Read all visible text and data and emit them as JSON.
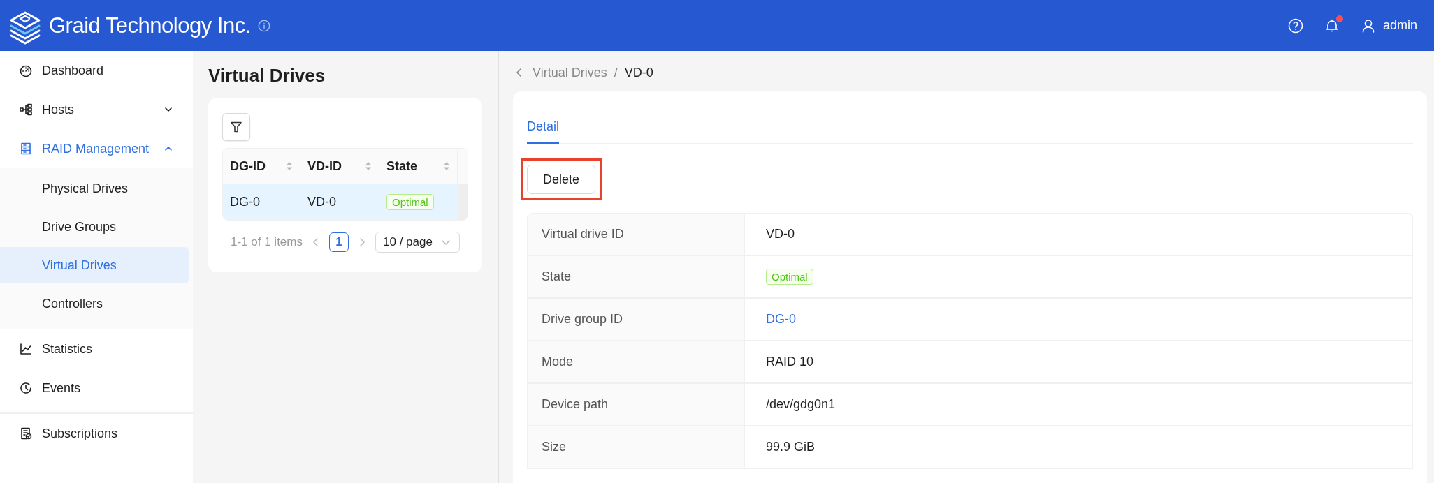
{
  "header": {
    "brand": "Graid Technology Inc.",
    "user": "admin",
    "notification_badge": true
  },
  "sidebar": {
    "items": [
      {
        "kind": "dashboard",
        "label": "Dashboard",
        "selected": false
      },
      {
        "kind": "hosts",
        "label": "Hosts",
        "selected": false,
        "expanded": false
      },
      {
        "kind": "raid",
        "label": "RAID Management",
        "selected": true,
        "expanded": true,
        "children": [
          {
            "label": "Physical Drives",
            "selected": false
          },
          {
            "label": "Drive Groups",
            "selected": false
          },
          {
            "label": "Virtual Drives",
            "selected": true
          },
          {
            "label": "Controllers",
            "selected": false
          }
        ]
      },
      {
        "kind": "statistics",
        "label": "Statistics",
        "selected": false
      },
      {
        "kind": "events",
        "label": "Events",
        "selected": false
      }
    ],
    "bottom_items": [
      {
        "kind": "subscriptions",
        "label": "Subscriptions",
        "selected": false
      }
    ]
  },
  "list_panel": {
    "title": "Virtual Drives",
    "table": {
      "columns": [
        "DG-ID",
        "VD-ID",
        "State"
      ],
      "rows": [
        {
          "dg_id": "DG-0",
          "vd_id": "VD-0",
          "state": "Optimal",
          "selected": true
        }
      ]
    },
    "pagination": {
      "summary": "1-1 of 1 items",
      "pages": [
        {
          "label": "1",
          "selected": true
        }
      ],
      "page_size": "10 / page"
    }
  },
  "detail_panel": {
    "breadcrumb": {
      "items": [
        "Virtual Drives",
        "VD-0"
      ],
      "separator": "/"
    },
    "tabs": [
      {
        "label": "Detail",
        "selected": true
      }
    ],
    "actions": [
      {
        "label": "Delete",
        "highlighted": true
      }
    ],
    "fields": [
      {
        "kind": "text",
        "label": "Virtual drive ID",
        "value": "VD-0"
      },
      {
        "kind": "tag",
        "label": "State",
        "value": "Optimal"
      },
      {
        "kind": "link",
        "label": "Drive group ID",
        "value": "DG-0"
      },
      {
        "kind": "text",
        "label": "Mode",
        "value": "RAID 10"
      },
      {
        "kind": "text",
        "label": "Device path",
        "value": "/dev/gdg0n1"
      },
      {
        "kind": "text",
        "label": "Size",
        "value": "99.9 GiB"
      }
    ]
  }
}
